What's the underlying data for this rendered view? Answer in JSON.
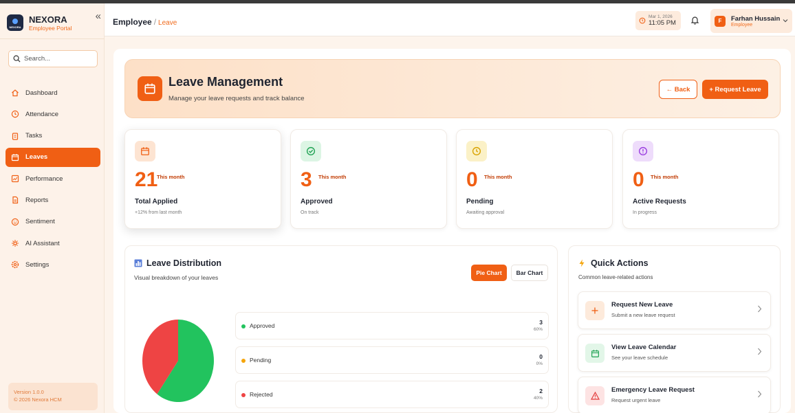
{
  "brand": {
    "name": "NEXORA",
    "subtitle": "Employee Portal",
    "logo_text": "NEXORA"
  },
  "search": {
    "placeholder": "Search..."
  },
  "sidebar": {
    "items": [
      {
        "label": "Dashboard",
        "icon": "home-icon"
      },
      {
        "label": "Attendance",
        "icon": "clock-icon"
      },
      {
        "label": "Tasks",
        "icon": "clipboard-icon"
      },
      {
        "label": "Leaves",
        "icon": "calendar-icon",
        "active": true
      },
      {
        "label": "Performance",
        "icon": "chart-icon"
      },
      {
        "label": "Reports",
        "icon": "document-icon"
      },
      {
        "label": "Sentiment",
        "icon": "smile-icon"
      },
      {
        "label": "AI Assistant",
        "icon": "sparkle-icon"
      },
      {
        "label": "Settings",
        "icon": "gear-icon"
      }
    ],
    "version": "Version 1.0.0",
    "copyright": "© 2026 Nexora HCM"
  },
  "header": {
    "breadcrumb_root": "Employee",
    "breadcrumb_sep": "/",
    "breadcrumb_current": "Leave",
    "date": "Mar 1, 2026",
    "time": "11:05 PM",
    "user_initial": "F",
    "user_name": "Farhan Hussain",
    "user_role": "Employee"
  },
  "hero": {
    "title": "Leave Management",
    "subtitle": "Manage your leave requests and track balance",
    "back_label": "← Back",
    "request_label": "+ Request Leave"
  },
  "stats": [
    {
      "value": "21",
      "badge": "This month",
      "label": "Total Applied",
      "sub": "+12% from last month",
      "icon": "calendar-icon",
      "color": "#f05f14",
      "bg": "#fde4d2"
    },
    {
      "value": "3",
      "badge": "This month",
      "label": "Approved",
      "sub": "On track",
      "icon": "check-circle-icon",
      "color": "#22a355",
      "bg": "#dcf5e4"
    },
    {
      "value": "0",
      "badge": "This month",
      "label": "Pending",
      "sub": "Awaiting approval",
      "icon": "clock-icon",
      "color": "#d9a300",
      "bg": "#fbf1c7"
    },
    {
      "value": "0",
      "badge": "This month",
      "label": "Active Requests",
      "sub": "In progress",
      "icon": "alert-circle-icon",
      "color": "#9b3fe0",
      "bg": "#eedcfb"
    }
  ],
  "distribution": {
    "title": "Leave Distribution",
    "subtitle": "Visual breakdown of your leaves",
    "pie_label": "Pie Chart",
    "bar_label": "Bar Chart",
    "rows": [
      {
        "name": "Approved",
        "count": "3",
        "pct": "60%",
        "color": "#22c35e"
      },
      {
        "name": "Pending",
        "count": "0",
        "pct": "0%",
        "color": "#f5a50b"
      },
      {
        "name": "Rejected",
        "count": "2",
        "pct": "40%",
        "color": "#ee4444"
      }
    ]
  },
  "chart_data": {
    "type": "pie",
    "categories": [
      "Approved",
      "Pending",
      "Rejected"
    ],
    "values": [
      3,
      0,
      2
    ],
    "colors": [
      "#22c35e",
      "#f5a50b",
      "#ee4444"
    ]
  },
  "quick_actions": {
    "title": "Quick Actions",
    "subtitle": "Common leave-related actions",
    "items": [
      {
        "name": "Request New Leave",
        "desc": "Submit a new leave request",
        "icon": "plus-icon",
        "color": "#f05f14",
        "bg": "#fdeadb"
      },
      {
        "name": "View Leave Calendar",
        "desc": "See your leave schedule",
        "icon": "calendar-icon",
        "color": "#22a355",
        "bg": "#e2f6e8"
      },
      {
        "name": "Emergency Leave Request",
        "desc": "Request urgent leave",
        "icon": "warning-icon",
        "color": "#e23b3b",
        "bg": "#fde3e3"
      }
    ]
  }
}
